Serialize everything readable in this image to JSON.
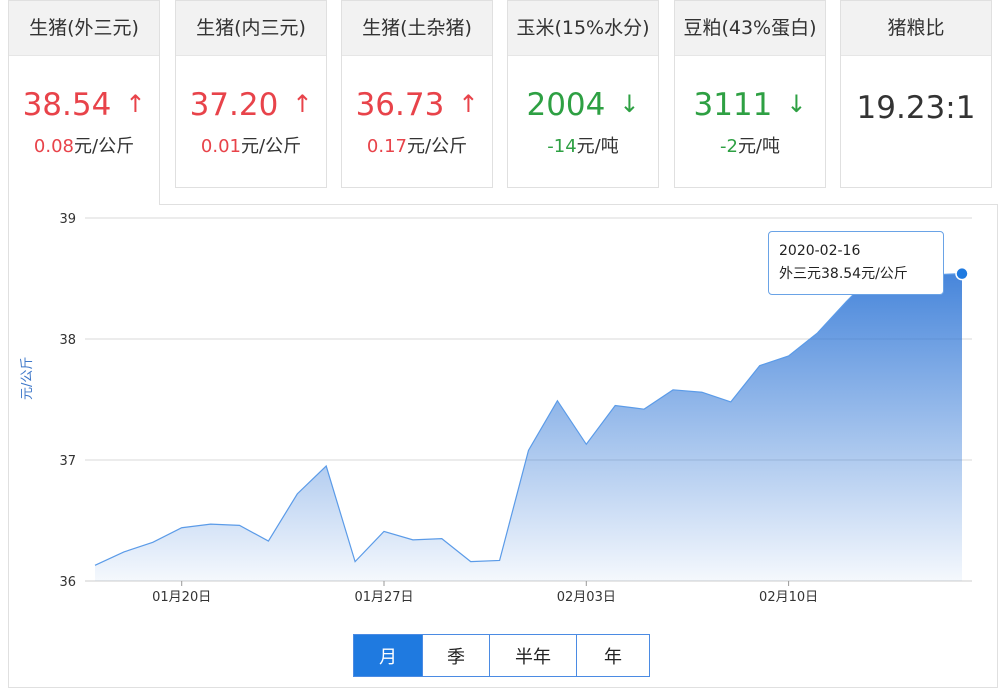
{
  "tabs": [
    {
      "title": "生猪(外三元)",
      "value": "38.54",
      "change_num": "0.08",
      "change_unit": "元/公斤",
      "trend": "up"
    },
    {
      "title": "生猪(内三元)",
      "value": "37.20",
      "change_num": "0.01",
      "change_unit": "元/公斤",
      "trend": "up"
    },
    {
      "title": "生猪(土杂猪)",
      "value": "36.73",
      "change_num": "0.17",
      "change_unit": "元/公斤",
      "trend": "up"
    },
    {
      "title": "玉米(15%水分)",
      "value": "2004",
      "change_num": "-14",
      "change_unit": "元/吨",
      "trend": "down"
    },
    {
      "title": "豆粕(43%蛋白)",
      "value": "3111",
      "change_num": "-2",
      "change_unit": "元/吨",
      "trend": "down"
    },
    {
      "title": "猪粮比",
      "value": "19.23:1",
      "change_num": "",
      "change_unit": "",
      "trend": "neutral"
    }
  ],
  "icons": {
    "up": "arrow-up-icon",
    "down": "arrow-down-icon"
  },
  "colors": {
    "up": "#e8434a",
    "down": "#2ea043",
    "accent": "#1f7ae0"
  },
  "tooltip": {
    "date": "2020-02-16",
    "text": "外三元38.54元/公斤"
  },
  "range_buttons": [
    "月",
    "季",
    "半年",
    "年"
  ],
  "active_range": "月",
  "chart_data": {
    "type": "area",
    "ylabel": "元/公斤",
    "ylim": [
      36,
      39
    ],
    "yticks": [
      36,
      37,
      38,
      39
    ],
    "x_dates": [
      "2020-01-17",
      "2020-01-18",
      "2020-01-19",
      "2020-01-20",
      "2020-01-21",
      "2020-01-22",
      "2020-01-23",
      "2020-01-24",
      "2020-01-25",
      "2020-01-26",
      "2020-01-27",
      "2020-01-28",
      "2020-01-29",
      "2020-01-30",
      "2020-01-31",
      "2020-02-01",
      "2020-02-02",
      "2020-02-03",
      "2020-02-04",
      "2020-02-05",
      "2020-02-06",
      "2020-02-07",
      "2020-02-08",
      "2020-02-09",
      "2020-02-10",
      "2020-02-11",
      "2020-02-12",
      "2020-02-13",
      "2020-02-14",
      "2020-02-15",
      "2020-02-16"
    ],
    "xticks": [
      {
        "label": "01月20日",
        "date": "2020-01-20"
      },
      {
        "label": "01月27日",
        "date": "2020-01-27"
      },
      {
        "label": "02月03日",
        "date": "2020-02-03"
      },
      {
        "label": "02月10日",
        "date": "2020-02-10"
      }
    ],
    "series": [
      {
        "values": [
          36.13,
          36.24,
          36.32,
          36.44,
          36.47,
          36.46,
          36.33,
          36.72,
          36.95,
          36.16,
          36.41,
          36.34,
          36.35,
          36.16,
          36.17,
          37.08,
          37.49,
          37.13,
          37.45,
          37.42,
          37.58,
          37.56,
          37.48,
          37.78,
          37.86,
          38.05,
          38.31,
          38.55,
          38.74,
          38.53,
          38.54
        ]
      }
    ],
    "grid": true
  }
}
